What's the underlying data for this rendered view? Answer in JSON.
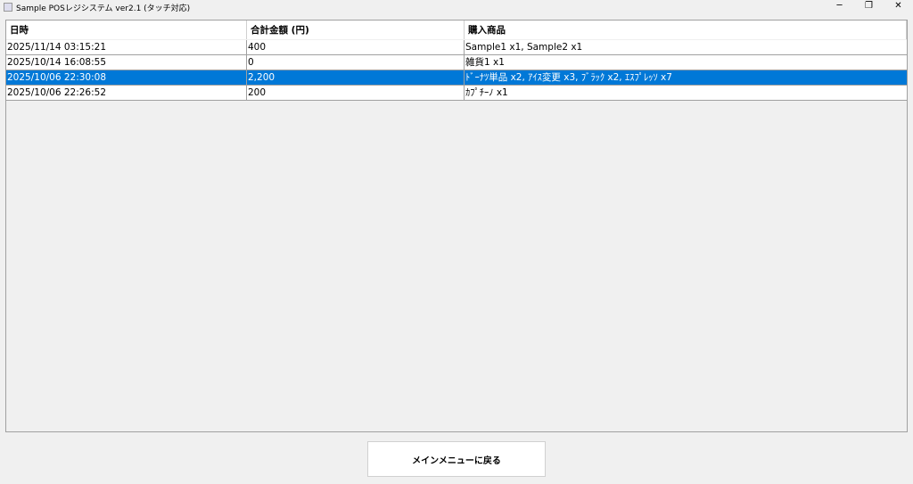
{
  "window": {
    "title": "Sample POSレジシステム ver2.1 (タッチ対応)",
    "minimize": "─",
    "restore": "❐",
    "close": "✕"
  },
  "table": {
    "columns": [
      "日時",
      "合計金額 (円)",
      "購入商品"
    ],
    "rows": [
      [
        "2025/11/14 03:15:21",
        "400",
        "Sample1 x1, Sample2 x1"
      ],
      [
        "2025/10/14 16:08:55",
        "0",
        "雑貨1 x1"
      ],
      [
        "2025/10/06 22:30:08",
        "2,200",
        "ﾄﾞｰﾅﾂ単品 x2, ｱｲｽ変更 x3, ﾌﾞﾗｯｸ x2, ｴｽﾌﾟﾚｯｿ x7"
      ],
      [
        "2025/10/06 22:26:52",
        "200",
        "ｶﾌﾟﾁｰﾉ x1"
      ]
    ],
    "selected_row": 2
  },
  "back_button": "メインメニューに戻る",
  "colors": {
    "selection": "#0078d7"
  }
}
